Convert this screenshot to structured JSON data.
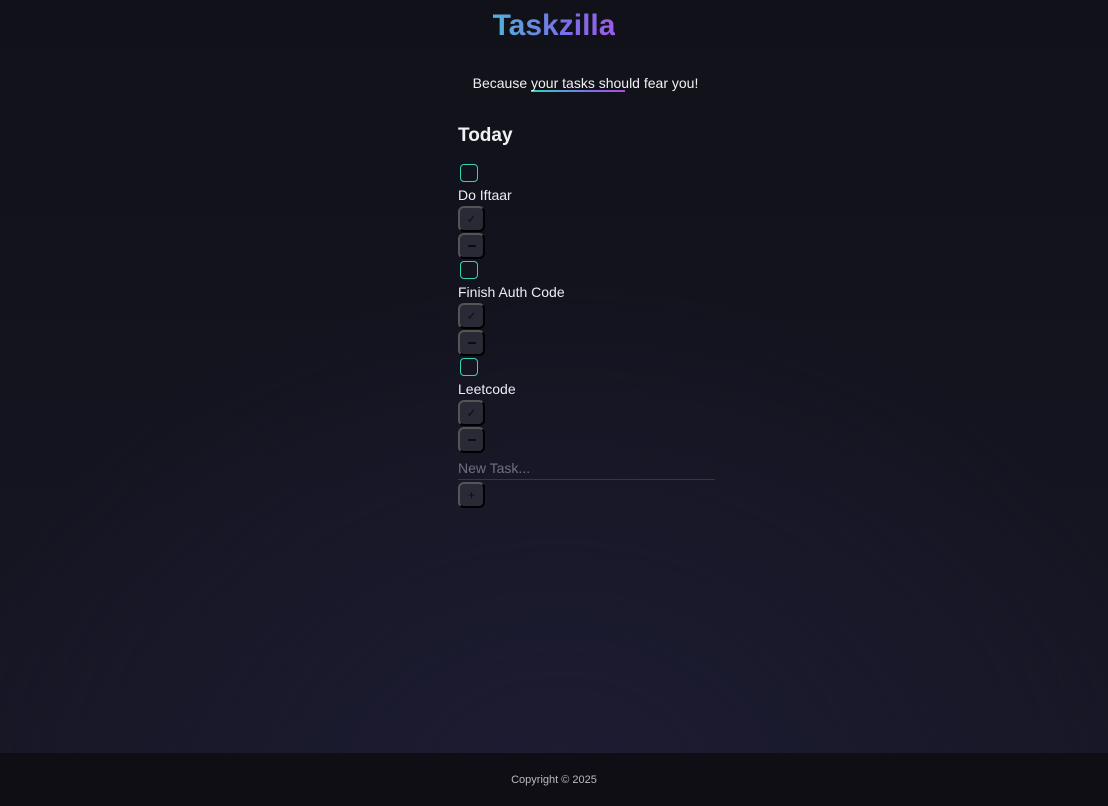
{
  "app": {
    "title": "Taskzilla",
    "tagline_before": "Because ",
    "tagline_highlight": "your tasks should",
    "tagline_after": " fear you!"
  },
  "section": {
    "heading": "Today"
  },
  "tasks": [
    {
      "label": "Do Iftaar",
      "done": false,
      "complete_label": "✓"
    },
    {
      "label": "Finish Auth Code",
      "done": false,
      "complete_label": "✓"
    },
    {
      "label": "Leetcode",
      "done": false,
      "complete_label": "✓"
    }
  ],
  "new_task": {
    "placeholder": "New Task...",
    "value": "",
    "add_label": "+"
  },
  "footer": {
    "copyright": "Copyright © 2025"
  },
  "colors": {
    "accent_teal": "#34d4b2",
    "gradient_start": "#4fb3d8",
    "gradient_end": "#9b5de5",
    "background": "#13131e"
  }
}
